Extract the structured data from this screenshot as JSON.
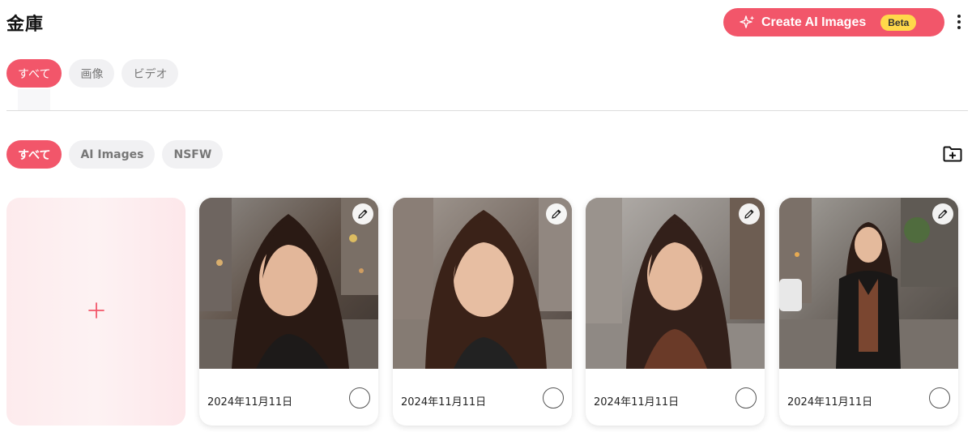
{
  "header": {
    "title": "金庫",
    "create_button": {
      "label": "Create AI Images",
      "badge": "Beta"
    }
  },
  "media_filters": [
    {
      "label": "すべて",
      "active": true
    },
    {
      "label": "画像",
      "active": false
    },
    {
      "label": "ビデオ",
      "active": false
    }
  ],
  "folder_filters": [
    {
      "label": "すべて",
      "active": true
    },
    {
      "label": "AI Images",
      "active": false
    },
    {
      "label": "NSFW",
      "active": false
    }
  ],
  "add_card": {
    "icon": "plus-icon"
  },
  "cards": [
    {
      "date": "2024年11月11日"
    },
    {
      "date": "2024年11月11日"
    },
    {
      "date": "2024年11月11日"
    },
    {
      "date": "2024年11月11日"
    }
  ],
  "colors": {
    "accent": "#f2566a",
    "badge": "#ffd84a",
    "pill_inactive": "#f1f1f3"
  }
}
